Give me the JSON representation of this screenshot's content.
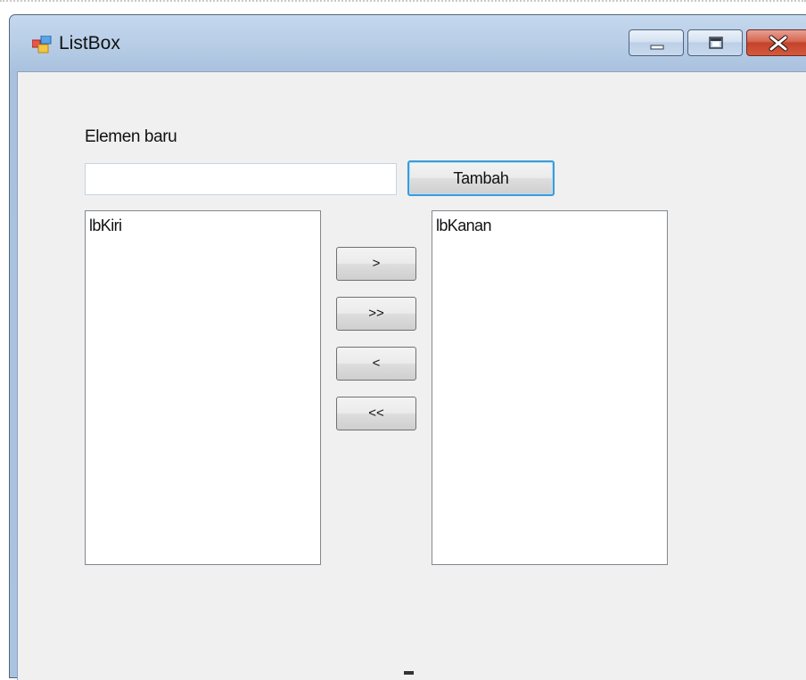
{
  "window": {
    "title": "ListBox",
    "icons": {
      "app": "windows-form-icon",
      "minimize": "minimize-icon",
      "maximize": "maximize-icon",
      "close": "close-icon"
    }
  },
  "form": {
    "new_element_label": "Elemen baru",
    "new_element_value": "",
    "add_button_label": "Tambah",
    "left_list": {
      "items": [
        "lbKiri"
      ]
    },
    "right_list": {
      "items": [
        "lbKanan"
      ]
    },
    "move_buttons": {
      "move_right": ">",
      "move_all_right": ">>",
      "move_left": "<",
      "move_all_left": "<<"
    }
  },
  "colors": {
    "client_background": "#f0f0f0",
    "focus_border": "#3c9bd8",
    "close_button": "#c4422a"
  }
}
